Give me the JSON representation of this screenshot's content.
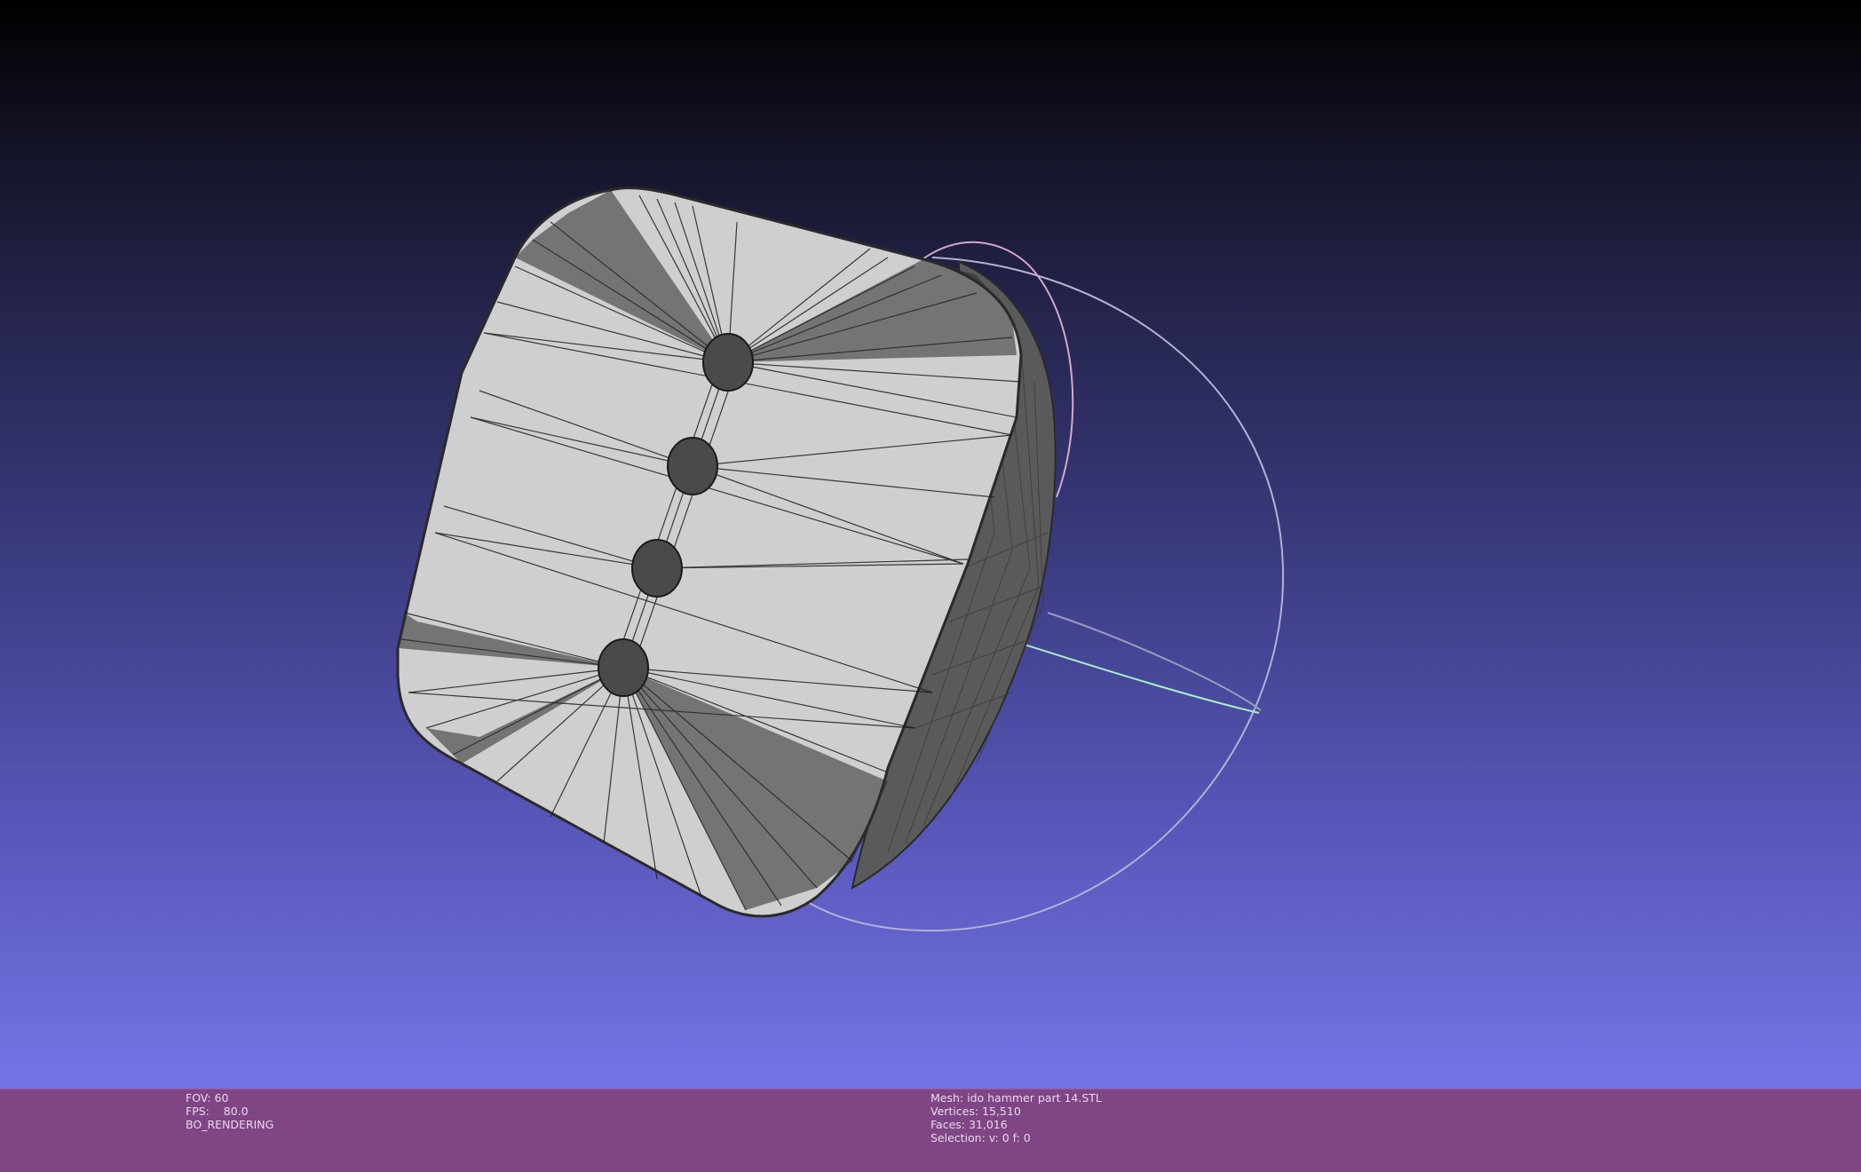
{
  "viewport": {
    "background_top": "#000000",
    "background_bottom": "#7474e6",
    "mesh_fill": "#cfcfcf",
    "wire_color": "#1e1e1e",
    "trackball_colors": [
      "#e8a0c0",
      "#b8b8d8",
      "#a8f0c8"
    ]
  },
  "status_left": {
    "fov": "FOV: 60",
    "fps": "FPS:    80.0",
    "mode": "BO_RENDERING"
  },
  "status_right": {
    "mesh": "Mesh: ido hammer part 14.STL",
    "vertices": "Vertices: 15,510",
    "faces": "Faces: 31,016",
    "selection": "Selection: v: 0 f: 0"
  },
  "infobar_color": "#7f4585"
}
